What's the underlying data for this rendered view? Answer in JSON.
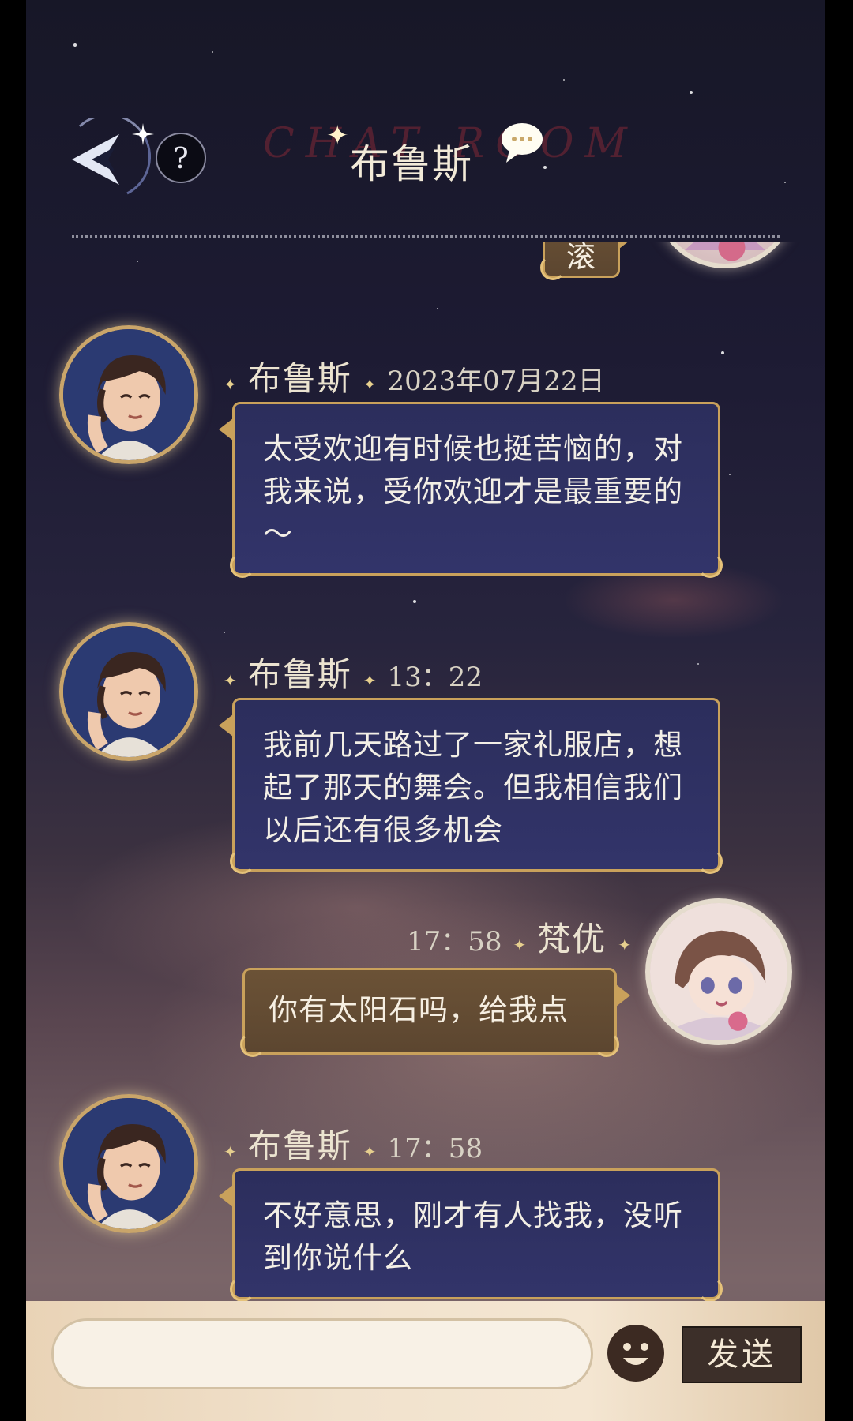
{
  "header": {
    "title": "布鲁斯",
    "watermark": "CHAT ROOM",
    "help_label": "?"
  },
  "messages": [
    {
      "sender": "梵优",
      "side": "right",
      "time": "",
      "text": "滚"
    },
    {
      "sender": "布鲁斯",
      "side": "left",
      "time": "2023年07月22日",
      "text": "太受欢迎有时候也挺苦恼的，对我来说，受你欢迎才是最重要的～"
    },
    {
      "sender": "布鲁斯",
      "side": "left",
      "time": "13：22",
      "text": "我前几天路过了一家礼服店，想起了那天的舞会。但我相信我们以后还有很多机会"
    },
    {
      "sender": "梵优",
      "side": "right",
      "time": "17：58",
      "text": "你有太阳石吗，给我点"
    },
    {
      "sender": "布鲁斯",
      "side": "left",
      "time": "17：58",
      "text": "不好意思，刚才有人找我，没听到你说什么"
    }
  ],
  "input": {
    "value": "",
    "placeholder": ""
  },
  "toolbar": {
    "emoji_icon": "smiley-face-icon",
    "send_label": "发送"
  },
  "colors": {
    "bubble_left": "#2c2e5c",
    "bubble_right": "#6b5236",
    "bubble_border": "#c9a15b",
    "send_button": "#3c2f29"
  }
}
